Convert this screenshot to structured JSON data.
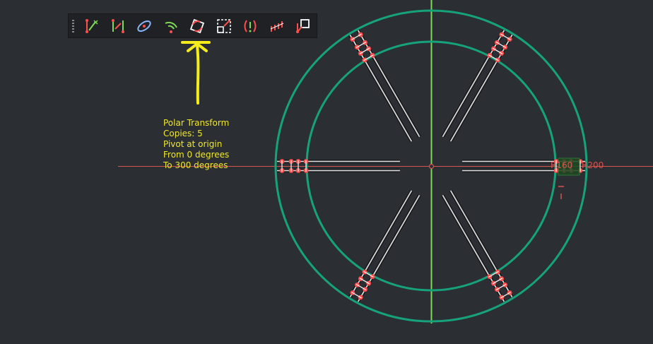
{
  "toolbar": {
    "tools": [
      {
        "name": "horizontal-constraint-icon"
      },
      {
        "name": "vertical-constraint-icon"
      },
      {
        "name": "ellipse-icon"
      },
      {
        "name": "arc-icon"
      },
      {
        "name": "polar-transform-icon"
      },
      {
        "name": "scale-icon"
      },
      {
        "name": "symmetry-icon"
      },
      {
        "name": "linear-array-icon"
      },
      {
        "name": "move-icon"
      }
    ]
  },
  "annotation": {
    "lines": [
      "Polar Transform",
      "Copies: 5",
      "Pivot at origin",
      "From 0 degrees",
      "To 300 degrees"
    ]
  },
  "dimensions": {
    "inner_label": "R160",
    "outer_label": "R200"
  },
  "colors": {
    "background": "#2b2e33",
    "circle": "#16a37c",
    "axis_horizontal": "#d9534f",
    "axis_vertical": "#7ed957",
    "annotation": "#f0e82a",
    "handle": "#ff4d4d"
  }
}
